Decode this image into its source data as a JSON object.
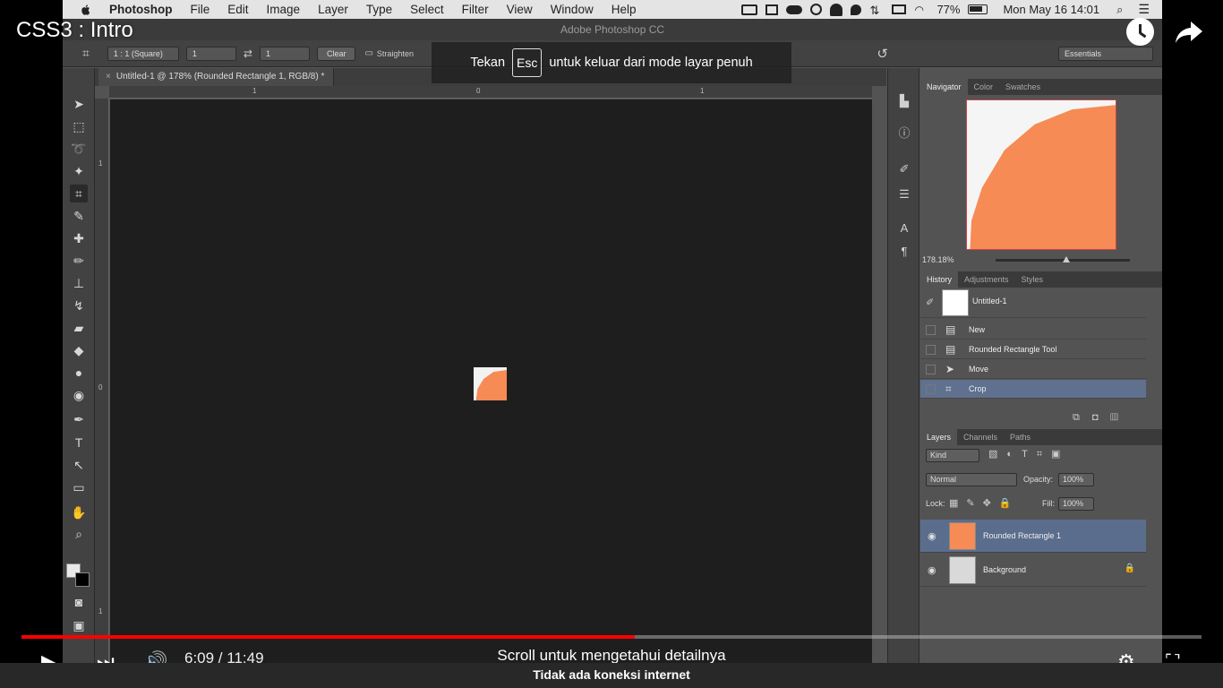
{
  "menubar": {
    "items": [
      "Photoshop",
      "File",
      "Edit",
      "Image",
      "Layer",
      "Type",
      "Select",
      "Filter",
      "View",
      "Window",
      "Help"
    ],
    "battery": "77%",
    "clock": "Mon May 16  14:01"
  },
  "ps": {
    "window_title": "Adobe Photoshop CC",
    "options": {
      "ratio": "1 : 1 (Square)",
      "width": "1",
      "height": "1",
      "clear": "Clear",
      "straighten": "Straighten",
      "workspace": "Essentials"
    },
    "doc_tab": "Untitled-1 @ 178% (Rounded Rectangle 1, RGB/8) *",
    "doc_close": "×",
    "ruler_top": [
      "1",
      "0",
      "1"
    ],
    "ruler_left": [
      "1",
      "0",
      "1"
    ],
    "navigator": {
      "tabs": [
        "Navigator",
        "Color",
        "Swatches"
      ],
      "zoom": "178.18%"
    },
    "history": {
      "tabs": [
        "History",
        "Adjustments",
        "Styles"
      ],
      "snapshot": "Untitled-1",
      "items": [
        "New",
        "Rounded Rectangle Tool",
        "Move",
        "Crop"
      ]
    },
    "layers": {
      "tabs": [
        "Layers",
        "Channels",
        "Paths"
      ],
      "kind": "Kind",
      "blend_mode": "Normal",
      "opacity_label": "Opacity:",
      "opacity": "100%",
      "lock_label": "Lock:",
      "fill_label": "Fill:",
      "fill": "100%",
      "items": [
        "Rounded Rectangle 1",
        "Background"
      ]
    },
    "colors": {
      "shape": "#f68b55",
      "selection": "#5f718f"
    }
  },
  "youtube": {
    "title": "CSS3 : Intro",
    "esc_before": "Tekan",
    "esc_key": "Esc",
    "esc_after": "untuk keluar dari mode layar penuh",
    "progress": 0.52,
    "time": "6:09 / 11:49",
    "scroll_hint": "Scroll untuk mengetahui detailnya",
    "offline": "Tidak ada koneksi internet"
  }
}
